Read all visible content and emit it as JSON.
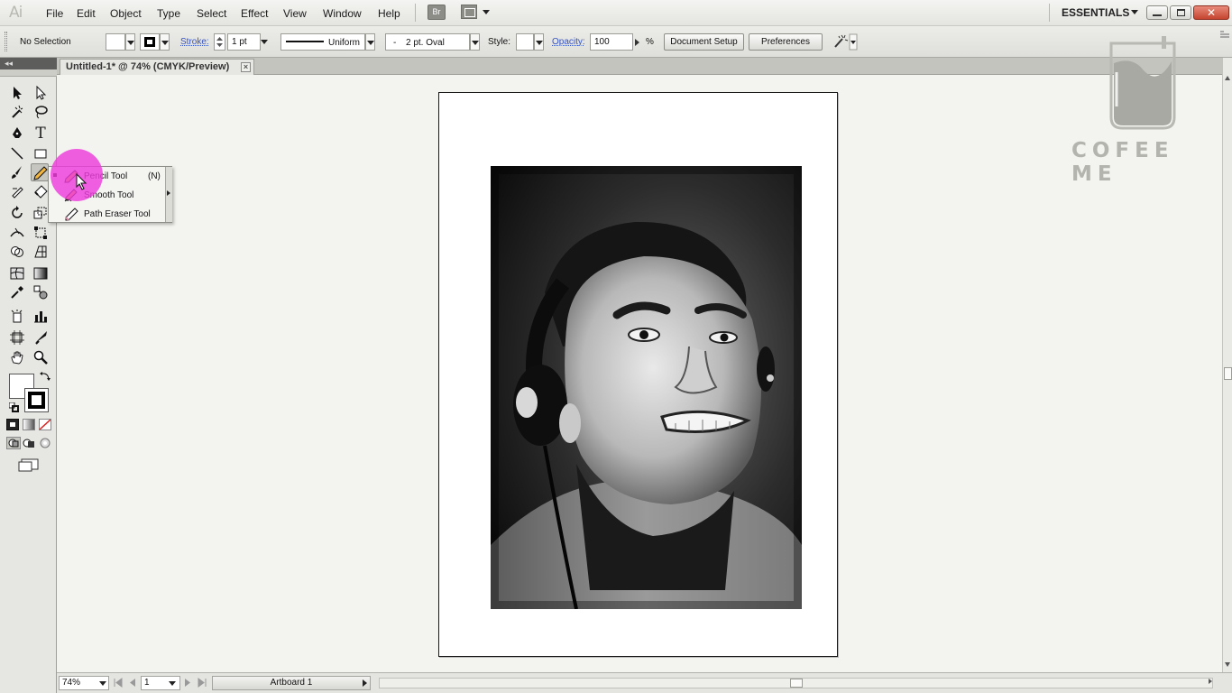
{
  "app": {
    "logo_text": "Ai"
  },
  "menubar": {
    "items": [
      "File",
      "Edit",
      "Object",
      "Type",
      "Select",
      "Effect",
      "View",
      "Window",
      "Help"
    ],
    "bridge_label": "Br",
    "workspace_label": "ESSENTIALS",
    "close_glyph": "✕"
  },
  "controlbar": {
    "selection_text": "No Selection",
    "stroke_label": "Stroke:",
    "stroke_weight": "1 pt",
    "profile_label": "Uniform",
    "brush_label": "2 pt. Oval",
    "brush_dot": "-",
    "style_label": "Style:",
    "opacity_label": "Opacity:",
    "opacity_value": "100",
    "opacity_unit": "%",
    "document_setup_label": "Document Setup",
    "preferences_label": "Preferences"
  },
  "toolpanel": {
    "header_glyph": "◂◂"
  },
  "document": {
    "tab_title": "Untitled-1* @ 74% (CMYK/Preview)",
    "tab_close": "×"
  },
  "flyout": {
    "items": [
      {
        "label": "Pencil Tool",
        "shortcut": "(N)",
        "icon": "pencil-icon",
        "selected": true
      },
      {
        "label": "Smooth Tool",
        "shortcut": "",
        "icon": "smooth-icon",
        "selected": false
      },
      {
        "label": "Path Eraser Tool",
        "shortcut": "",
        "icon": "path-eraser-icon",
        "selected": false
      }
    ]
  },
  "statusbar": {
    "zoom": "74%",
    "artboard_number": "1",
    "artboard_label": "Artboard 1"
  },
  "watermark": {
    "text": "COFEE ME"
  },
  "colors": {
    "highlight": "#ee3cdc",
    "link": "#3553c4",
    "close_button": "#c4442f"
  }
}
